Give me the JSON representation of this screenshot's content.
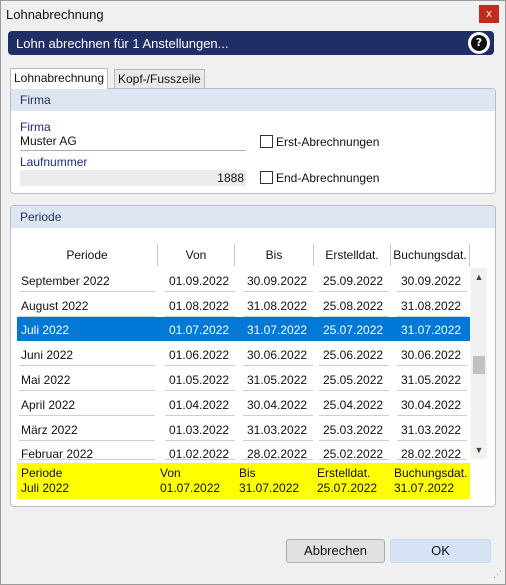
{
  "window": {
    "title": "Lohnabrechnung",
    "close_glyph": "x"
  },
  "banner": {
    "text": "Lohn abrechnen für 1 Anstellungen...",
    "help_glyph": "?"
  },
  "tabs": [
    {
      "label": "Lohnabrechnung",
      "active": true
    },
    {
      "label": "Kopf-/Fusszeile",
      "active": false
    }
  ],
  "firma_section": {
    "title": "Firma",
    "firma_label": "Firma",
    "firma_value": "Muster AG",
    "laufnummer_label": "Laufnummer",
    "laufnummer_value": "1888",
    "erst_label": "Erst-Abrechnungen",
    "erst_checked": false,
    "end_label": "End-Abrechnungen",
    "end_checked": false
  },
  "periode_section": {
    "title": "Periode",
    "columns": [
      "Periode",
      "Von",
      "Bis",
      "Erstelldat.",
      "Buchungsdat."
    ],
    "rows": [
      [
        "September 2022",
        "01.09.2022",
        "30.09.2022",
        "25.09.2022",
        "30.09.2022"
      ],
      [
        "August 2022",
        "01.08.2022",
        "31.08.2022",
        "25.08.2022",
        "31.08.2022"
      ],
      [
        "Juli 2022",
        "01.07.2022",
        "31.07.2022",
        "25.07.2022",
        "31.07.2022"
      ],
      [
        "Juni 2022",
        "01.06.2022",
        "30.06.2022",
        "25.06.2022",
        "30.06.2022"
      ],
      [
        "Mai 2022",
        "01.05.2022",
        "31.05.2022",
        "25.05.2022",
        "31.05.2022"
      ],
      [
        "April 2022",
        "01.04.2022",
        "30.04.2022",
        "25.04.2022",
        "30.04.2022"
      ],
      [
        "März 2022",
        "01.03.2022",
        "31.03.2022",
        "25.03.2022",
        "31.03.2022"
      ],
      [
        "Februar 2022",
        "01.02.2022",
        "28.02.2022",
        "25.02.2022",
        "28.02.2022"
      ]
    ],
    "selected_index": 2,
    "scroll_up_glyph": "▲",
    "scroll_down_glyph": "▼",
    "summary": {
      "labels": [
        "Periode",
        "Von",
        "Bis",
        "Erstelldat.",
        "Buchungsdat."
      ],
      "values": [
        "Juli 2022",
        "01.07.2022",
        "31.07.2022",
        "25.07.2022",
        "31.07.2022"
      ]
    }
  },
  "buttons": {
    "cancel": "Abbrechen",
    "ok": "OK"
  },
  "colors": {
    "banner": "#1f2f66",
    "selection": "#0078d7",
    "summary_highlight": "#ffff00",
    "section_header": "#dfe6f3",
    "label_blue": "#1c2a85"
  }
}
